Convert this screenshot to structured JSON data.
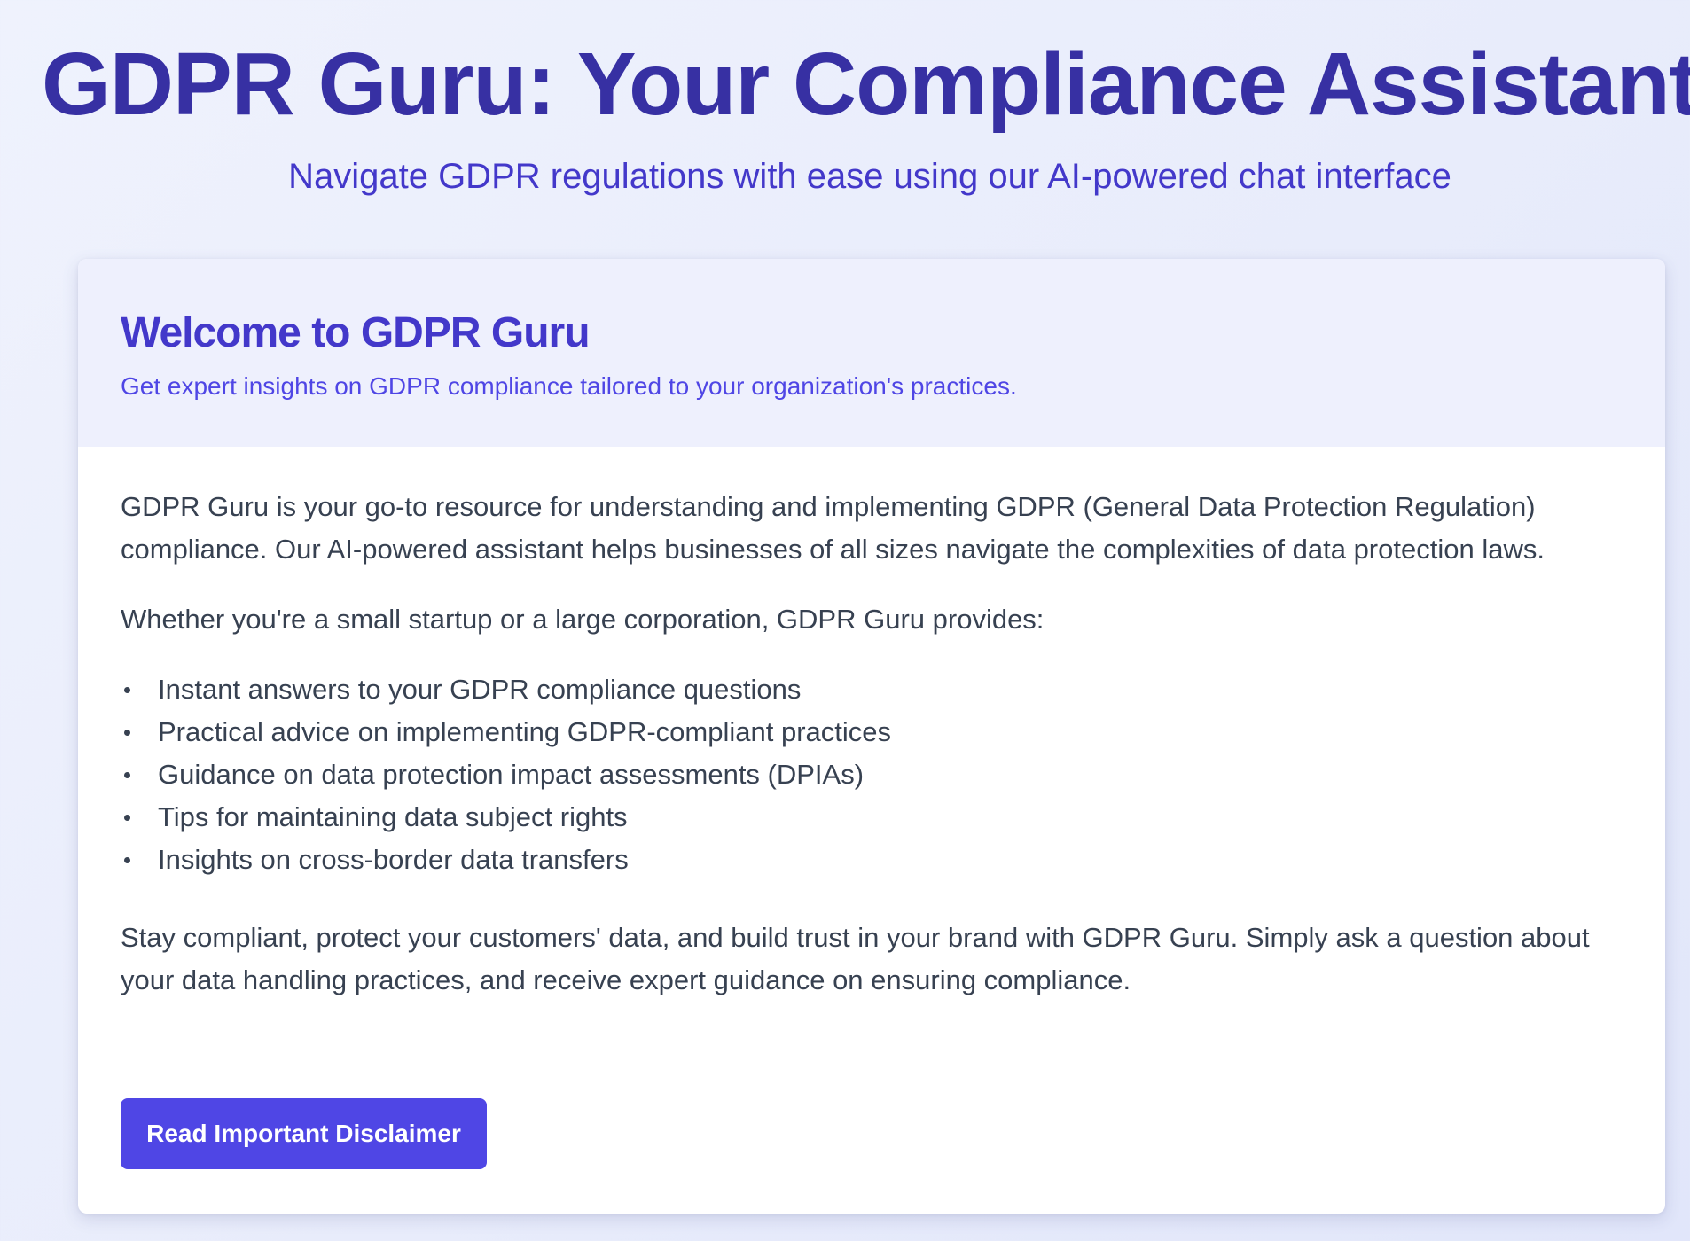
{
  "header": {
    "title": "GDPR Guru: Your Compliance Assistant",
    "subtitle": "Navigate GDPR regulations with ease using our AI-powered chat interface"
  },
  "card": {
    "title": "Welcome to GDPR Guru",
    "description": "Get expert insights on GDPR compliance tailored to your organization's practices.",
    "intro": "GDPR Guru is your go-to resource for understanding and implementing GDPR (General Data Protection Regulation) compliance. Our AI-powered assistant helps businesses of all sizes navigate the complexities of data protection laws.",
    "lead": "Whether you're a small startup or a large corporation, GDPR Guru provides:",
    "features": [
      "Instant answers to your GDPR compliance questions",
      "Practical advice on implementing GDPR-compliant practices",
      "Guidance on data protection impact assessments (DPIAs)",
      "Tips for maintaining data subject rights",
      "Insights on cross-border data transfers"
    ],
    "closing": "Stay compliant, protect your customers' data, and build trust in your brand with GDPR Guru. Simply ask a question about your data handling practices, and receive expert guidance on ensuring compliance.",
    "button_label": "Read Important Disclaimer"
  },
  "colors": {
    "title": "#3730a3",
    "accent": "#4f46e5",
    "card_header_bg": "#eef0fd",
    "body_text": "#374151"
  }
}
